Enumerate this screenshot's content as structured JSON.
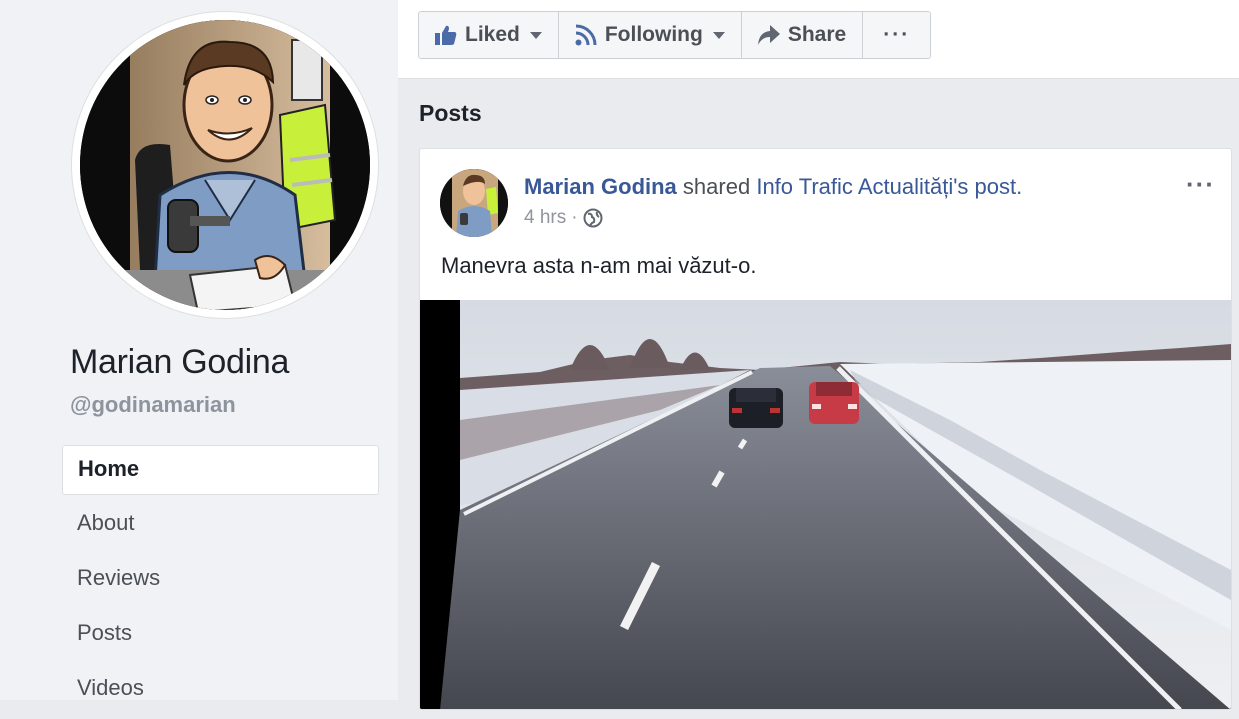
{
  "profile": {
    "name": "Marian Godina",
    "handle": "@godinamarian"
  },
  "nav": {
    "items": [
      {
        "label": "Home",
        "active": true
      },
      {
        "label": "About",
        "active": false
      },
      {
        "label": "Reviews",
        "active": false
      },
      {
        "label": "Posts",
        "active": false
      },
      {
        "label": "Videos",
        "active": false
      }
    ]
  },
  "toolbar": {
    "liked_label": "Liked",
    "following_label": "Following",
    "share_label": "Share",
    "more_label": "···"
  },
  "posts_section": {
    "heading": "Posts"
  },
  "post": {
    "author": "Marian Godina",
    "action": "shared",
    "shared_source": "Info Trafic Actualități's post.",
    "time": "4 hrs",
    "separator": "·",
    "privacy_icon": "globe-icon",
    "text": "Manevra asta n-am mai văzut-o.",
    "options_label": "···"
  },
  "colors": {
    "link": "#385898",
    "background": "#e9ebee",
    "panel": "#ffffff",
    "muted": "#90949c"
  }
}
